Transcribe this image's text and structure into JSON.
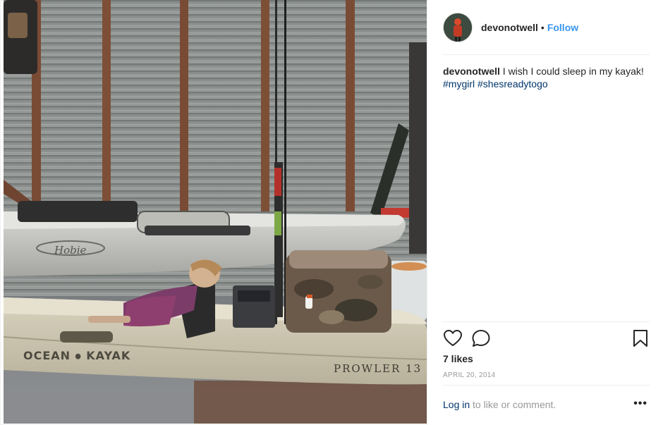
{
  "post": {
    "username": "devonotwell",
    "separator": "•",
    "follow_label": "Follow",
    "caption_user": "devonotwell",
    "caption_text": " I wish I could sleep in my kayak!",
    "hashtags": [
      "#mygirl",
      "#shesreadytogo"
    ],
    "likes": "7 likes",
    "date": "APRIL 20, 2014",
    "login_link": "Log in",
    "login_rest": " to like or comment.",
    "more_label": "•••"
  },
  "photo": {
    "kayak_top_logo": "Hobie",
    "kayak_bottom_logo": "OCEAN ⦁ KAYAK",
    "kayak_model": "PROWLER 13"
  },
  "icons": {
    "like": "heart-outline-icon",
    "comment": "comment-bubble-icon",
    "save": "bookmark-icon",
    "more": "more-options-icon"
  },
  "colors": {
    "link_blue": "#3897f0",
    "hashtag_navy": "#003569",
    "muted_gray": "#999999",
    "text": "#262626"
  }
}
